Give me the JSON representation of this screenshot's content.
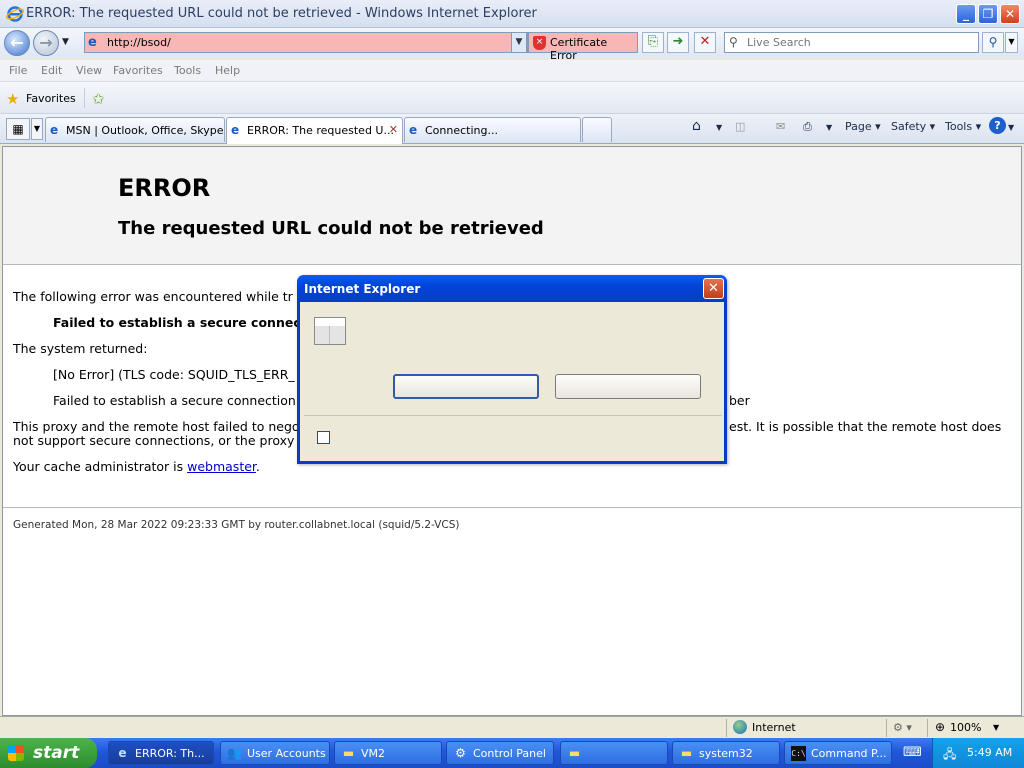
{
  "window": {
    "title": "ERROR: The requested URL could not be retrieved - Windows Internet Explorer"
  },
  "address_bar": {
    "url": "http://bsod/",
    "cert_error": "Certificate Error",
    "search_placeholder": "Live Search"
  },
  "menu": [
    "File",
    "Edit",
    "View",
    "Favorites",
    "Tools",
    "Help"
  ],
  "favorites_bar": {
    "label": "Favorites"
  },
  "tabs": [
    {
      "label": "MSN | Outlook, Office, Skype..."
    },
    {
      "label": "ERROR: The requested U..."
    },
    {
      "label": "Connecting..."
    }
  ],
  "command_bar": {
    "page": "Page",
    "safety": "Safety",
    "tools": "Tools"
  },
  "page": {
    "heading": "ERROR",
    "subheading": "The requested URL could not be retrieved",
    "intro": "The following error was encountered while tr",
    "error_bold": "Failed to establish a secure connectio",
    "system_returned": "The system returned:",
    "no_error": "[No Error] (TLS code: SQUID_TLS_ERR_",
    "failed2_left": "Failed to establish a secure connection",
    "failed2_right": "ber",
    "proxy_left_1": "This proxy and the remote host failed to nego",
    "proxy_right_1": "est. It is possible that the remote host does",
    "proxy_left_2": "not support secure connections, or the proxy",
    "admin_prefix": "Your cache administrator is ",
    "admin_link": "webmaster",
    "admin_suffix": ".",
    "generated": "Generated Mon, 28 Mar 2022 09:23:33 GMT by router.collabnet.local (squid/5.2-VCS)"
  },
  "dialog": {
    "title": "Internet Explorer"
  },
  "status_bar": {
    "zone": "Internet",
    "zoom": "100%"
  },
  "taskbar": {
    "start": "start",
    "items": [
      {
        "label": "ERROR: Th...",
        "icon": "ie-icon"
      },
      {
        "label": "User Accounts",
        "icon": "user-accounts-icon"
      },
      {
        "label": "VM2",
        "icon": "folder-icon"
      },
      {
        "label": "Control Panel",
        "icon": "control-panel-icon"
      },
      {
        "label": "",
        "icon": "folder-icon"
      },
      {
        "label": "system32",
        "icon": "folder-icon"
      },
      {
        "label": "Command P...",
        "icon": "cmd-icon"
      }
    ],
    "clock": "5:49 AM"
  },
  "colors": {
    "address_error": "#f7b7b7",
    "taskbar": "#2157d8",
    "start": "#2d8c2d",
    "dialog_titlebar": "#0044d8"
  }
}
